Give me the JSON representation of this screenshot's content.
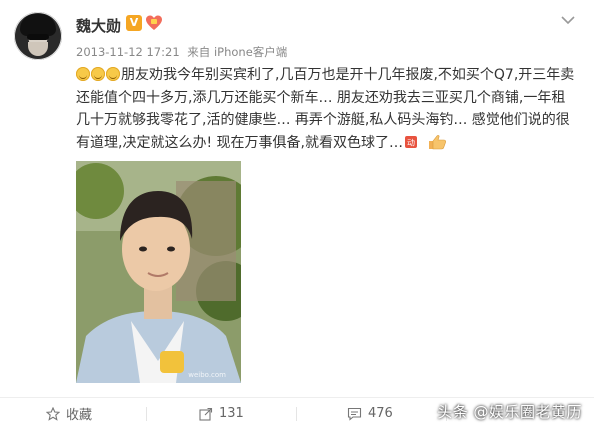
{
  "post": {
    "username": "魏大勋",
    "verified_badge": "V",
    "timestamp": "2013-11-12 17:21",
    "source": "来自 iPhone客户端",
    "content_lines": [
      "朋友劝我今年别买宾利了,几百万也是开十几年报废,不如买个Q7,开三年卖",
      "还能值个四十多万,添几万还能买个新车… 朋友还劝我去三亚买几个商铺,一年租",
      "几十万就够我零花了,活的健康些… 再弄个游艇,私人码头海钓… 感觉他们说的很",
      "有道理,决定就这么办! 现在万事俱备,就看双色球了…"
    ],
    "emoji_count": 3,
    "photo_alt": "selfie",
    "accent": "#f5a623"
  },
  "actions": {
    "favorite_label": "收藏",
    "forward_count": "131",
    "comment_count": "476"
  },
  "watermark": "头条 @娱乐圈老黄历",
  "icons": {
    "favorite": "star-icon",
    "forward": "share-icon",
    "comment": "comment-icon",
    "more": "chevron-down-icon"
  }
}
